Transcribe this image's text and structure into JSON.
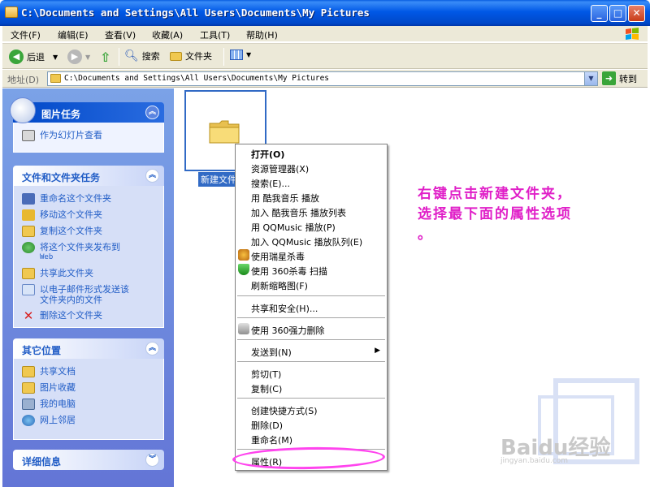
{
  "window": {
    "title": "C:\\Documents and Settings\\All Users\\Documents\\My Pictures",
    "min": "_",
    "max": "□",
    "close": "✕"
  },
  "menubar": {
    "file": "文件(F)",
    "edit": "编辑(E)",
    "view": "查看(V)",
    "favorites": "收藏(A)",
    "tools": "工具(T)",
    "help": "帮助(H)"
  },
  "toolbar": {
    "back": "后退",
    "search": "搜索",
    "folders": "文件夹"
  },
  "address": {
    "label": "地址(D)",
    "value": "C:\\Documents and Settings\\All Users\\Documents\\My Pictures",
    "go": "转到"
  },
  "leftpane": {
    "picture_tasks": {
      "title": "图片任务",
      "items": [
        "作为幻灯片查看"
      ]
    },
    "file_tasks": {
      "title": "文件和文件夹任务",
      "items": [
        {
          "label": "重命名这个文件夹"
        },
        {
          "label": "移动这个文件夹"
        },
        {
          "label": "复制这个文件夹"
        },
        {
          "label": "将这个文件夹发布到",
          "sub": "Web"
        },
        {
          "label": "共享此文件夹"
        },
        {
          "label": "以电子邮件形式发送该",
          "sub": "文件夹内的文件"
        },
        {
          "label": "删除这个文件夹"
        }
      ]
    },
    "other_places": {
      "title": "其它位置",
      "items": [
        "共享文档",
        "图片收藏",
        "我的电脑",
        "网上邻居"
      ]
    },
    "details": {
      "title": "详细信息"
    }
  },
  "main": {
    "folder_label": "新建文件",
    "annotation_line1": "右键点击新建文件夹，",
    "annotation_line2": "选择最下面的属性选项",
    "annotation_line3": "。",
    "watermark_text": "Baidu经验",
    "watermark_url": "jingyan.baidu.com"
  },
  "context_menu": {
    "open": "打开(O)",
    "explorer": "资源管理器(X)",
    "search": "搜索(E)...",
    "kuwo_play": "用 酷我音乐 播放",
    "kuwo_add": "加入 酷我音乐 播放列表",
    "qq_play": "用 QQMusic 播放(P)",
    "qq_add": "加入 QQMusic 播放队列(E)",
    "rising": "使用瑞星杀毒",
    "scan360": "使用 360杀毒 扫描",
    "refresh_thumbs": "刷新缩略图(F)",
    "share_security": "共享和安全(H)...",
    "delete360": "使用 360强力删除",
    "send_to": "发送到(N)",
    "cut": "剪切(T)",
    "copy": "复制(C)",
    "shortcut": "创建快捷方式(S)",
    "delete": "删除(D)",
    "rename": "重命名(M)",
    "properties": "属性(R)"
  }
}
